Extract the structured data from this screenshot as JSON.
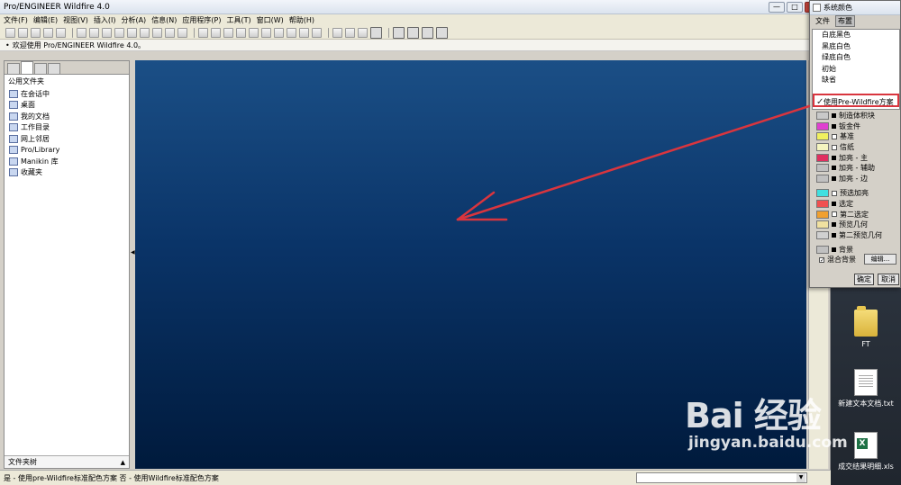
{
  "window": {
    "title": "Pro/ENGINEER Wildfire 4.0",
    "min": "—",
    "max": "□",
    "close": "✕"
  },
  "menubar": [
    "文件(F)",
    "编辑(E)",
    "视图(V)",
    "插入(I)",
    "分析(A)",
    "信息(N)",
    "应用程序(P)",
    "工具(T)",
    "窗口(W)",
    "帮助(H)"
  ],
  "infobar": {
    "text": "欢迎使用 Pro/ENGINEER Wildfire 4.0。"
  },
  "navigator": {
    "header": "公用文件夹",
    "items": [
      "在会话中",
      "桌面",
      "我的文档",
      "工作目录",
      "网上邻居",
      "Pro/Library",
      "Manikin 库",
      "收藏夹"
    ],
    "footer": "文件夹树"
  },
  "statusbar": {
    "text": "是 - 使用pre-Wildfire标准配色方案 否 - 使用Wildfire标准配色方案"
  },
  "dialog": {
    "title": "系统颜色",
    "menu": [
      "文件",
      "布置"
    ],
    "dropdown": [
      "白底黑色",
      "黑底白色",
      "绿底白色",
      "初始",
      "缺省"
    ],
    "check_item": "使用Pre-Wildfire方案",
    "color_rows": [
      {
        "label": "制造体积块",
        "color": "#c9c9c9",
        "kind": "dot"
      },
      {
        "label": "钣金件",
        "color": "#e040d0",
        "kind": "dot"
      },
      {
        "label": "基准",
        "color": "#f0f060",
        "kind": "check"
      },
      {
        "label": "信纸",
        "color": "#f5f5c0",
        "kind": "check"
      },
      {
        "label": "加亮 - 主",
        "color": "#e03060",
        "kind": "dot"
      },
      {
        "label": "加亮 - 辅助",
        "color": "#c0c0c0",
        "kind": "dot"
      },
      {
        "label": "加亮 - 边",
        "color": "#c0c0c0",
        "kind": "dot"
      },
      {
        "label": "预选加亮",
        "color": "#40e0e0",
        "kind": "check"
      },
      {
        "label": "选定",
        "color": "#f05050",
        "kind": "dot"
      },
      {
        "label": "第二选定",
        "color": "#f0a030",
        "kind": "check"
      },
      {
        "label": "预览几何",
        "color": "#f0e0a0",
        "kind": "dot"
      },
      {
        "label": "第二预览几何",
        "color": "#d0d0d0",
        "kind": "dot"
      },
      {
        "label": "背景",
        "color": "#c0c0c0",
        "kind": "dot"
      }
    ],
    "blend_bg": "混合背景",
    "edit_button": "编辑...",
    "ok_button": "确定",
    "cancel_button": "取消"
  },
  "desktop": {
    "icons": [
      {
        "label": "FT",
        "type": "folder"
      },
      {
        "label": "新建文本文档.txt",
        "type": "txt"
      },
      {
        "label": "成交结果明细.xls",
        "type": "xls"
      }
    ]
  },
  "watermark": {
    "logo": "Bai 经验",
    "url": "jingyan.baidu.com"
  },
  "colors": {
    "viewport_top": "#1b4f86",
    "viewport_bottom": "#001a3c",
    "annotation_red": "#d9353e"
  }
}
